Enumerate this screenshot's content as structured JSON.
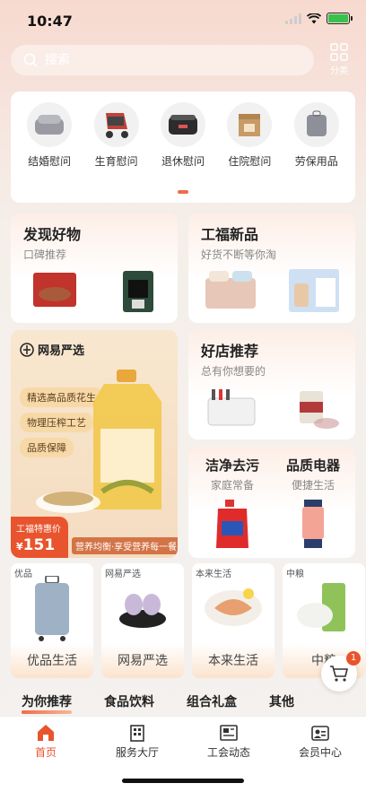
{
  "status": {
    "time": "10:47"
  },
  "search": {
    "placeholder": "搜索"
  },
  "category_button": {
    "label": "分类"
  },
  "quick_items": [
    {
      "label": "结婚慰问"
    },
    {
      "label": "生育慰问"
    },
    {
      "label": "退休慰问"
    },
    {
      "label": "住院慰问"
    },
    {
      "label": "劳保用品"
    }
  ],
  "discover": {
    "title": "发现好物",
    "subtitle": "口碑推荐"
  },
  "new_goods": {
    "title": "工福新品",
    "subtitle": "好货不断等你淘"
  },
  "yanxuan": {
    "brand": "网易严选",
    "tags": [
      "精选高品质花生",
      "物理压榨工艺",
      "品质保障"
    ],
    "price_label": "工福特惠价",
    "price": "151",
    "currency": "¥",
    "slogan": "营养均衡·享受营养每一餐"
  },
  "good_shop": {
    "title": "好店推荐",
    "subtitle": "总有你想要的"
  },
  "clean": {
    "title": "洁净去污",
    "subtitle": "家庭常备"
  },
  "appliance": {
    "title": "品质电器",
    "subtitle": "便捷生活"
  },
  "brands": [
    {
      "tag": "优品",
      "name": "优品生活"
    },
    {
      "tag": "网易严选",
      "name": "网易严选"
    },
    {
      "tag": "本来生活",
      "name": "本来生活"
    },
    {
      "tag": "中粮",
      "name": "中粮"
    }
  ],
  "cart": {
    "count": "1"
  },
  "category_tabs": [
    "为你推荐",
    "食品饮料",
    "组合礼盒",
    "其他"
  ],
  "tab_bar": [
    {
      "label": "首页"
    },
    {
      "label": "服务大厅"
    },
    {
      "label": "工会动态"
    },
    {
      "label": "会员中心"
    }
  ],
  "colors": {
    "accent": "#e8542d",
    "promo_bg": "#f8e7cf"
  }
}
